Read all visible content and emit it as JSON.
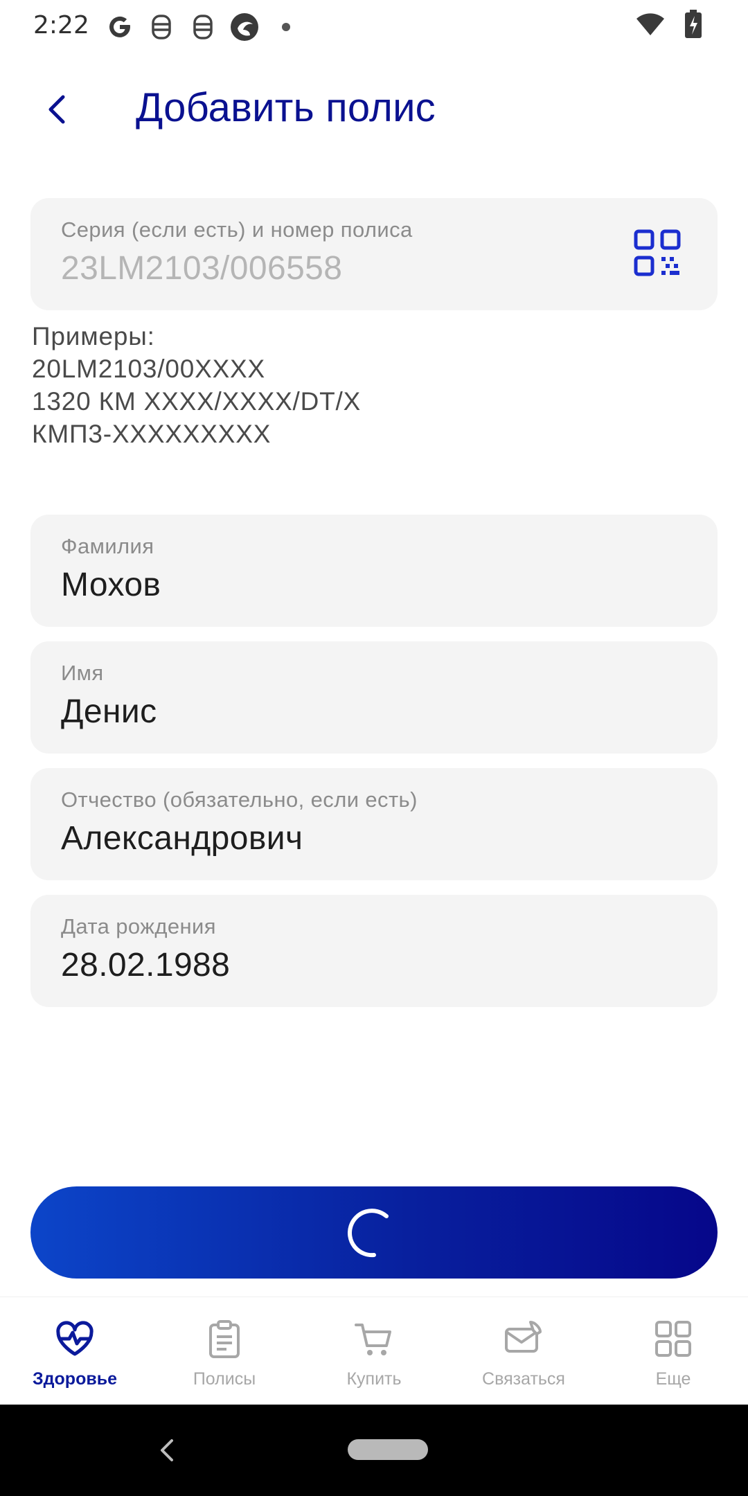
{
  "status_bar": {
    "time": "2:22",
    "icons": [
      "google-icon",
      "notification-icon",
      "notification-icon",
      "app-icon",
      "dot-icon"
    ],
    "right_icons": [
      "wifi-icon",
      "battery-charging-icon"
    ]
  },
  "header": {
    "title": "Добавить полис",
    "back_icon": "chevron-left-icon"
  },
  "policy_field": {
    "label": "Серия (если есть) и номер полиса",
    "placeholder": "23LM2103/006558",
    "scan_icon": "qr-code-icon"
  },
  "examples": {
    "heading": "Примеры:",
    "lines": [
      "20LM2103/00XXXX",
      "1320 КМ XXXX/XXXX/DT/X",
      "КМП3-XXXXXXXXX"
    ]
  },
  "fields": {
    "surname": {
      "label": "Фамилия",
      "value": "Мохов"
    },
    "name": {
      "label": "Имя",
      "value": "Денис"
    },
    "patronymic": {
      "label": "Отчество (обязательно, если есть)",
      "value": "Александрович"
    },
    "birthdate": {
      "label": "Дата рождения",
      "value": "28.02.1988"
    }
  },
  "submit": {
    "state": "loading",
    "spinner_icon": "spinner-icon",
    "gradient": [
      "#0c45c9",
      "#06078a"
    ]
  },
  "bottom_nav": {
    "items": [
      {
        "label": "Здоровье",
        "icon": "heart-pulse-icon",
        "active": true
      },
      {
        "label": "Полисы",
        "icon": "clipboard-icon",
        "active": false
      },
      {
        "label": "Купить",
        "icon": "cart-icon",
        "active": false
      },
      {
        "label": "Связаться",
        "icon": "phone-mail-icon",
        "active": false
      },
      {
        "label": "Еще",
        "icon": "grid-icon",
        "active": false
      }
    ]
  },
  "colors": {
    "accent": "#0a1190",
    "field_bg": "#f4f4f4",
    "nav_active": "#0b1a9b",
    "nav_inactive": "#a7a7a7"
  }
}
